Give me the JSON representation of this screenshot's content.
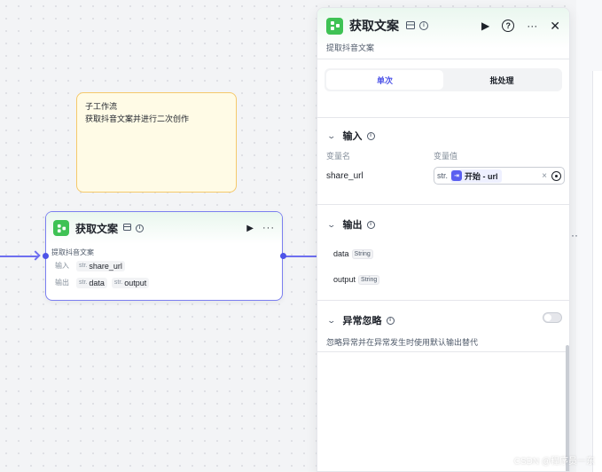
{
  "canvas": {
    "note": {
      "line1": "子工作流",
      "line2": "获取抖音文案并进行二次创作"
    },
    "node": {
      "title": "获取文案",
      "description": "提取抖音文案",
      "input_label": "输入",
      "input_type": "str.",
      "input_value": "share_url",
      "output_label": "输出",
      "outputs": [
        {
          "type": "str.",
          "name": "data"
        },
        {
          "type": "str.",
          "name": "output"
        }
      ]
    },
    "bg_more": "···"
  },
  "panel": {
    "title": "获取文案",
    "description": "提取抖音文案",
    "tabs": [
      {
        "label": "单次",
        "active": true
      },
      {
        "label": "批处理",
        "active": false
      }
    ],
    "input_section": {
      "title": "输入",
      "col_name": "变量名",
      "col_value": "变量值",
      "row": {
        "name": "share_url",
        "type": "str.",
        "ref": "开始 - url"
      }
    },
    "output_section": {
      "title": "输出",
      "items": [
        {
          "name": "data",
          "type": "String"
        },
        {
          "name": "output",
          "type": "String"
        }
      ]
    },
    "exception_section": {
      "title": "异常忽略",
      "description": "忽略异常并在异常发生时使用默认输出替代",
      "enabled": false
    }
  },
  "watermark": "CSDN @程序员一东",
  "colors": {
    "accent": "#4d53e8",
    "edge": "#6e6ff0",
    "app_green": "#3ec254",
    "note_bg": "#fffbe6",
    "note_border": "#f5c96b"
  }
}
